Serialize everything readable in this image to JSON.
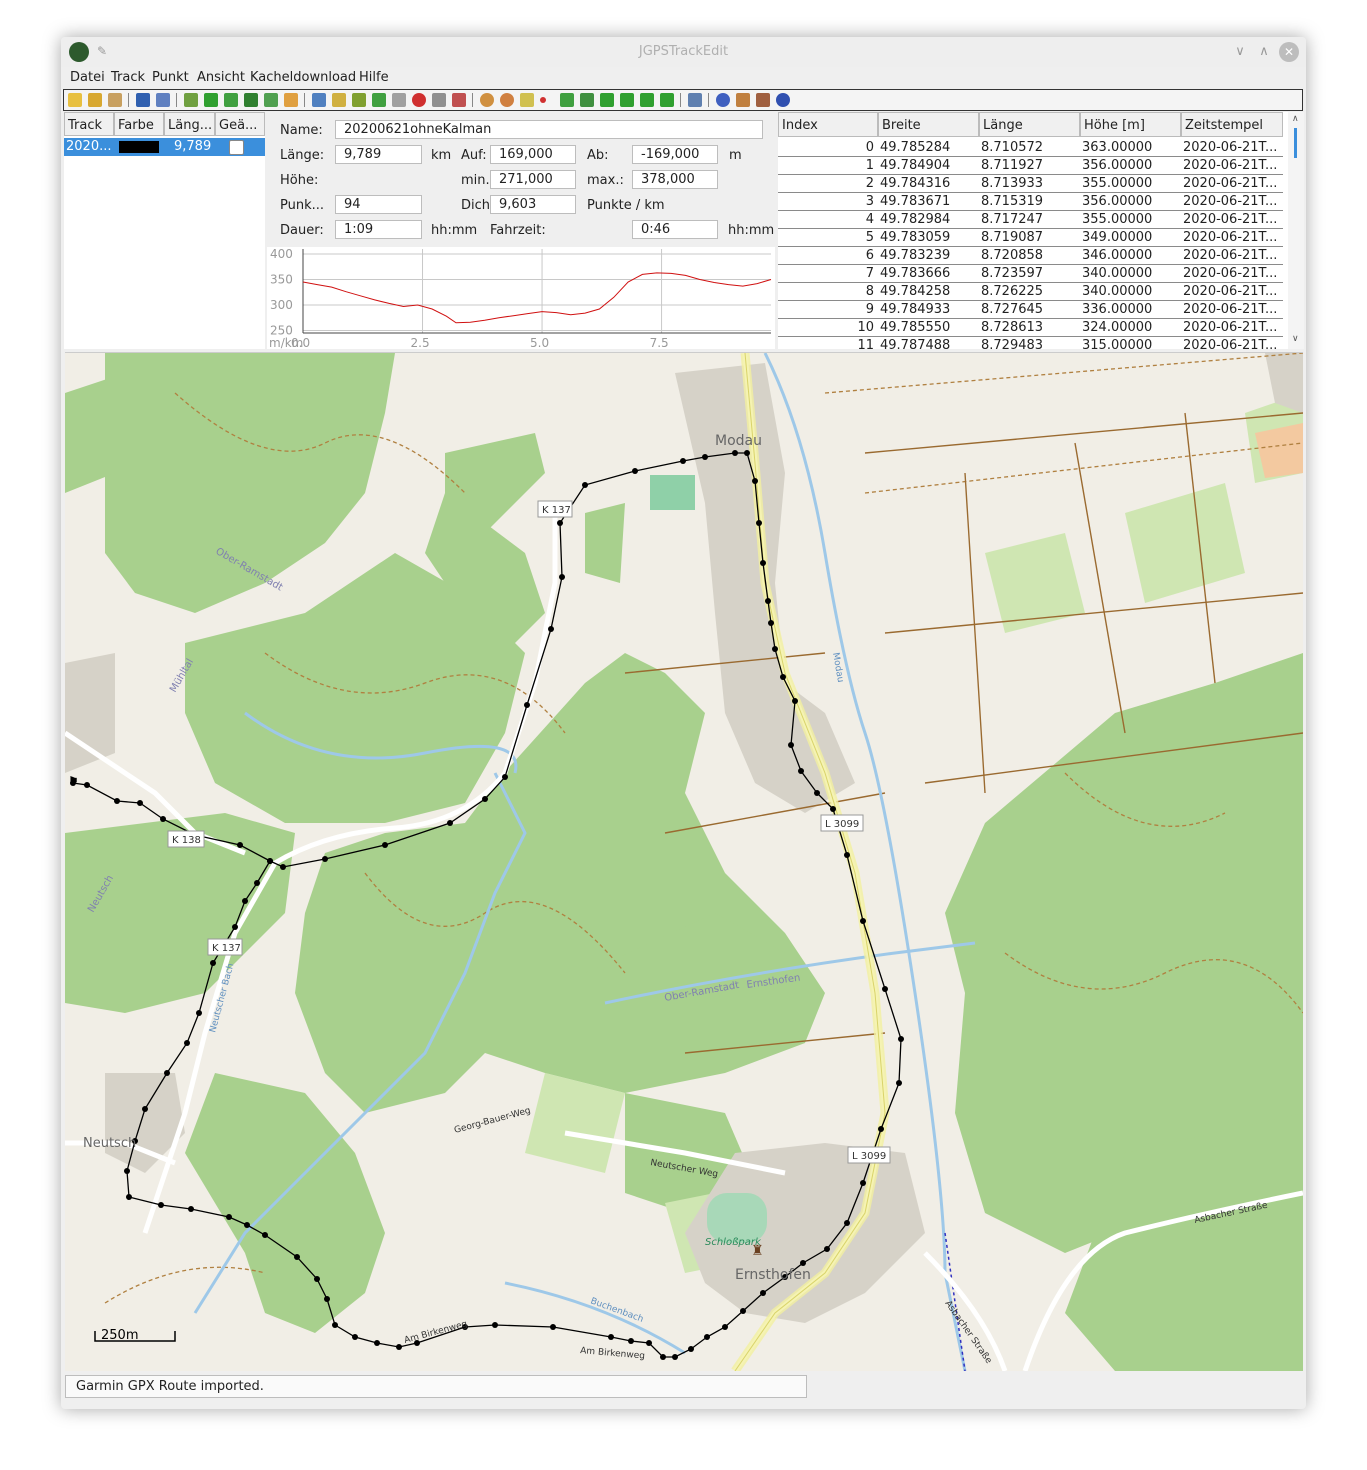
{
  "window": {
    "title": "JGPSTrackEdit"
  },
  "menu": [
    "Datei",
    "Track",
    "Punkt",
    "Ansicht",
    "Kacheldownload",
    "Hilfe"
  ],
  "track_table": {
    "headers": [
      "Track",
      "Farbe",
      "Läng...",
      "Geä..."
    ],
    "rows": [
      {
        "name": "2020...",
        "color": "#000000",
        "length": "9,789"
      }
    ]
  },
  "info": {
    "name_label": "Name:",
    "name_value": "20200621ohneKalman",
    "laenge_label": "Länge:",
    "laenge_value": "9,789",
    "km_unit": "km",
    "auf_label": "Auf:",
    "auf_value": "169,000",
    "ab_label": "Ab:",
    "ab_value": "-169,000",
    "m_unit": "m",
    "hoehe_label": "Höhe:",
    "min_label": "min.:",
    "min_value": "271,000",
    "max_label": "max.:",
    "max_value": "378,000",
    "punkte_label": "Punk...",
    "punkte_value": "94",
    "dichte_label": "Dichte:",
    "dichte_value": "9,603",
    "punkte_km_label": "Punkte / km",
    "dauer_label": "Dauer:",
    "dauer_value": "1:09",
    "hhmm1": "hh:mm",
    "fahrzeit_label": "Fahrzeit:",
    "fahrzeit_value": "0:46",
    "hhmm2": "hh:mm"
  },
  "chart_data": {
    "type": "line",
    "title": "",
    "xlabel": "m/km",
    "ylabel": "",
    "xlim": [
      0,
      9.789
    ],
    "ylim": [
      245,
      400
    ],
    "x_ticks": [
      "0.0",
      "2.5",
      "5.0",
      "7.5"
    ],
    "y_ticks": [
      "400",
      "350",
      "300",
      "250"
    ],
    "color": "#d01010",
    "x": [
      0,
      0.3,
      0.6,
      0.9,
      1.2,
      1.5,
      1.8,
      2.1,
      2.4,
      2.7,
      3.0,
      3.2,
      3.5,
      3.8,
      4.1,
      4.4,
      4.7,
      5.0,
      5.3,
      5.6,
      5.9,
      6.2,
      6.5,
      6.8,
      7.1,
      7.4,
      7.7,
      8.0,
      8.3,
      8.6,
      8.9,
      9.2,
      9.5,
      9.789
    ],
    "y": [
      345,
      340,
      335,
      326,
      318,
      310,
      303,
      297,
      300,
      292,
      278,
      265,
      266,
      270,
      275,
      279,
      283,
      287,
      285,
      281,
      284,
      292,
      315,
      345,
      360,
      363,
      362,
      358,
      350,
      344,
      340,
      337,
      342,
      350
    ]
  },
  "points_table": {
    "headers": [
      "Index",
      "Breite",
      "Länge",
      "Höhe [m]",
      "Zeitstempel"
    ],
    "rows": [
      [
        "0",
        "49.785284",
        "8.710572",
        "363.00000",
        "2020-06-21T..."
      ],
      [
        "1",
        "49.784904",
        "8.711927",
        "356.00000",
        "2020-06-21T..."
      ],
      [
        "2",
        "49.784316",
        "8.713933",
        "355.00000",
        "2020-06-21T..."
      ],
      [
        "3",
        "49.783671",
        "8.715319",
        "356.00000",
        "2020-06-21T..."
      ],
      [
        "4",
        "49.782984",
        "8.717247",
        "355.00000",
        "2020-06-21T..."
      ],
      [
        "5",
        "49.783059",
        "8.719087",
        "349.00000",
        "2020-06-21T..."
      ],
      [
        "6",
        "49.783239",
        "8.720858",
        "346.00000",
        "2020-06-21T..."
      ],
      [
        "7",
        "49.783666",
        "8.723597",
        "340.00000",
        "2020-06-21T..."
      ],
      [
        "8",
        "49.784258",
        "8.726225",
        "340.00000",
        "2020-06-21T..."
      ],
      [
        "9",
        "49.784933",
        "8.727645",
        "336.00000",
        "2020-06-21T..."
      ],
      [
        "10",
        "49.785550",
        "8.728613",
        "324.00000",
        "2020-06-21T..."
      ],
      [
        "11",
        "49.787488",
        "8.729483",
        "315.00000",
        "2020-06-21T..."
      ]
    ]
  },
  "map": {
    "places": [
      "Modau",
      "Neutsch",
      "Ernsthofen"
    ],
    "road_labels": [
      "K 137",
      "K 138",
      "K 137",
      "L 3099",
      "L 3099"
    ],
    "street_labels": [
      "Ober-Ramstadt",
      "Mühltal",
      "Neutsch",
      "Neutscher Bach",
      "Ober-Ramstadt",
      "Ernsthofen",
      "Georg-Bauer-Weg",
      "Neutscher Weg",
      "Asbacher Straße",
      "Asbacher Straße",
      "Modau",
      "Schloßpark",
      "Buchenbach",
      "Am Birkenweg",
      "Am Birkenweg"
    ],
    "scale_label": "250m"
  },
  "status": {
    "message": "Garmin GPX Route imported."
  }
}
